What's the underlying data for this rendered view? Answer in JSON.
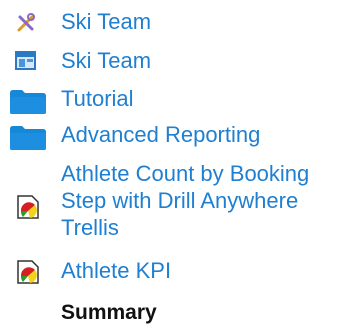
{
  "tree": {
    "items": [
      {
        "label": "Ski Team",
        "icon": "wrench-cross-icon",
        "kind": "link"
      },
      {
        "label": "Ski Team",
        "icon": "dashboard-window-icon",
        "kind": "link"
      },
      {
        "label": "Tutorial",
        "icon": "folder-icon",
        "kind": "link"
      },
      {
        "label": "Advanced Reporting",
        "icon": "folder-icon",
        "kind": "link"
      },
      {
        "label_lines": [
          "Athlete Count by Booking",
          "Step with Drill Anywhere",
          "Trellis"
        ],
        "icon": "report-chart-icon",
        "kind": "link"
      },
      {
        "label": "Athlete KPI",
        "icon": "report-chart-icon",
        "kind": "link"
      },
      {
        "label": "Summary",
        "kind": "current"
      }
    ]
  },
  "colors": {
    "link": "#1f7fd1",
    "current": "#111111",
    "folder": "#1688d8",
    "report_red": "#d42020",
    "report_yellow": "#f4d21a",
    "report_green": "#2e9a2e"
  }
}
